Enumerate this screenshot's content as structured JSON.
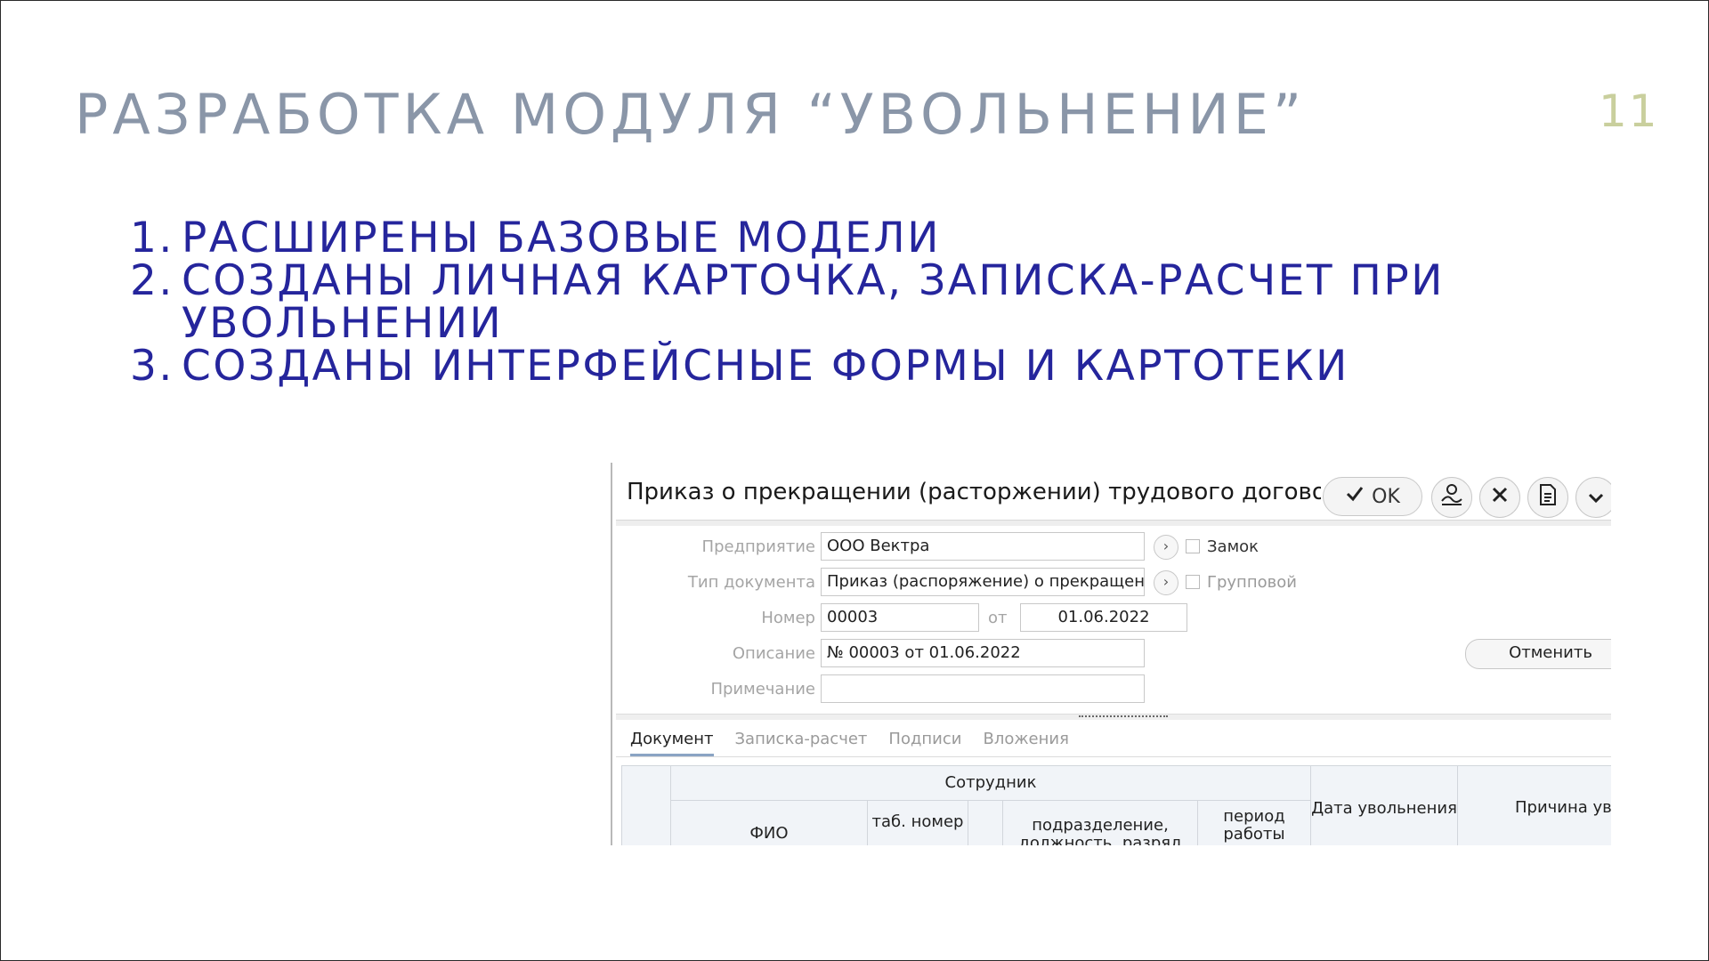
{
  "slide": {
    "title": "РАЗРАБОТКА МОДУЛЯ “УВОЛЬНЕНИЕ”",
    "number": "11",
    "bullets": [
      {
        "num": "1.",
        "text": "РАСШИРЕНЫ БАЗОВЫЕ МОДЕЛИ"
      },
      {
        "num": "2.",
        "text": "СОЗДАНЫ ЛИЧНАЯ КАРТОЧКА, ЗАПИСКА-РАСЧЕТ ПРИ",
        "text2": "УВОЛЬНЕНИИ"
      },
      {
        "num": "3.",
        "text": "СОЗДАНЫ ИНТЕРФЕЙСНЫЕ ФОРМЫ И КАРТОТЕКИ"
      }
    ],
    "colors": {
      "title": "#8a96a8",
      "bullets": "#25259c",
      "number": "#c9cf9d"
    }
  },
  "form": {
    "title": "Приказ о прекращении (расторжении) трудового договора",
    "toolbar": {
      "ok_label": "OK",
      "icons": [
        "check-icon",
        "sign-icon",
        "close-icon",
        "document-icon",
        "chevron-down-icon"
      ]
    },
    "fields": {
      "enterprise_label": "Предприятие",
      "enterprise_value": "ООО Вектра",
      "doctype_label": "Тип документа",
      "doctype_value": "Приказ (распоряжение) о прекращении (расторжении) трудового договора",
      "number_label": "Номер",
      "number_value": "00003",
      "from_label": "от",
      "date_value": "01.06.2022",
      "description_label": "Описание",
      "description_value": "№ 00003 от 01.06.2022",
      "note_label": "Примечание",
      "note_value": ""
    },
    "checkboxes": {
      "lock_label": "Замок",
      "lock_checked": false,
      "group_label": "Групповой",
      "group_checked": false
    },
    "cancel_label": "Отменить",
    "tabs": [
      {
        "label": "Документ",
        "active": true
      },
      {
        "label": "Записка-расчет",
        "active": false
      },
      {
        "label": "Подписи",
        "active": false
      },
      {
        "label": "Вложения",
        "active": false
      }
    ],
    "grid_headers": {
      "group_employee": "Сотрудник",
      "fio": "ФИО",
      "tab_number": "таб. номер",
      "division": "подразделение, должность, разряд",
      "period": "период работы",
      "dismissal_date": "Дата увольнения",
      "reason": "Причина увольнения"
    }
  }
}
